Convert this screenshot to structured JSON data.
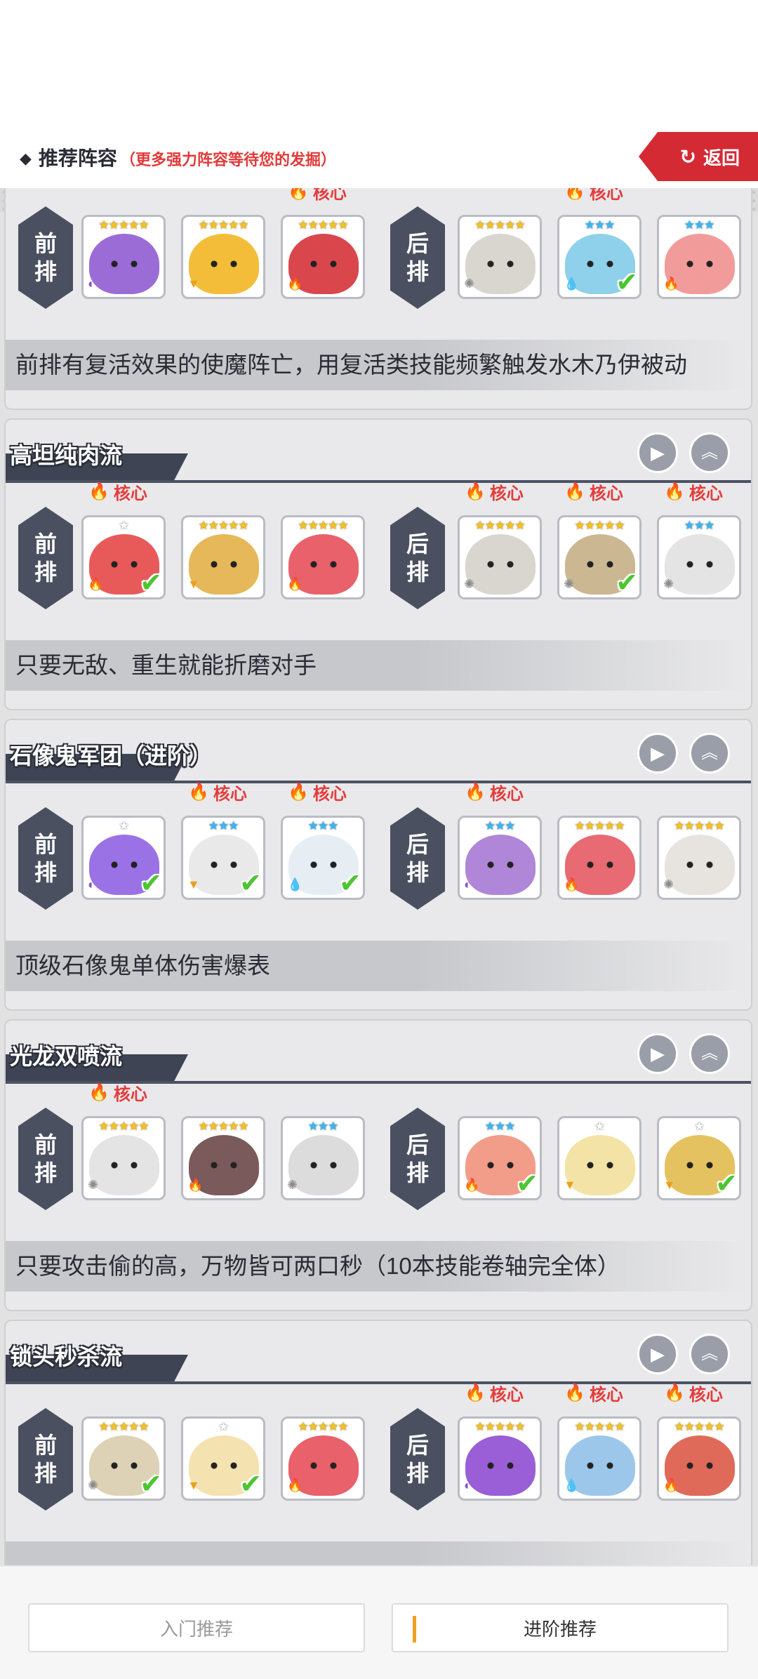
{
  "header": {
    "title": "推荐阵容",
    "subtitle": "（更多强力阵容等待您的发掘）",
    "back_label": "返回"
  },
  "labels": {
    "front": [
      "前",
      "排"
    ],
    "back": [
      "后",
      "排"
    ],
    "core": "核心"
  },
  "teams": [
    {
      "title": "",
      "description": "前排有复活效果的使魔阵亡，用复活类技能频繁触发水木乃伊被动",
      "heroes": [
        {
          "stars": "★★★★★",
          "star_color": "gold",
          "color": "#9b6cd6",
          "element": "dark",
          "core": false,
          "owned": false
        },
        {
          "stars": "★★★★★",
          "star_color": "gold",
          "color": "#f3bd3a",
          "element": "earth",
          "core": false,
          "owned": false
        },
        {
          "stars": "★★★★★",
          "star_color": "gold",
          "color": "#d9474d",
          "element": "fire",
          "core": true,
          "owned": false
        },
        {
          "stars": "★★★★★",
          "star_color": "gold",
          "color": "#d9d6d0",
          "element": "light",
          "core": false,
          "owned": false
        },
        {
          "stars": "★★★",
          "star_color": "blue",
          "color": "#8fd0ea",
          "element": "water",
          "core": true,
          "owned": true
        },
        {
          "stars": "★★★",
          "star_color": "blue",
          "color": "#f29b9b",
          "element": "fire",
          "core": false,
          "owned": false
        }
      ]
    },
    {
      "title": "高坦纯肉流",
      "description": "只要无敌、重生就能折磨对手",
      "heroes": [
        {
          "stars": "★",
          "star_color": "white",
          "color": "#e85a5a",
          "element": "fire",
          "core": true,
          "owned": true
        },
        {
          "stars": "★★★★★",
          "star_color": "gold",
          "color": "#e6b85a",
          "element": "earth",
          "core": false,
          "owned": false
        },
        {
          "stars": "★★★★★",
          "star_color": "gold",
          "color": "#e8616b",
          "element": "fire",
          "core": false,
          "owned": false
        },
        {
          "stars": "★★★★★",
          "star_color": "gold",
          "color": "#d9d6d0",
          "element": "light",
          "core": true,
          "owned": false
        },
        {
          "stars": "★★★★★",
          "star_color": "gold",
          "color": "#cbb892",
          "element": "light",
          "core": true,
          "owned": true
        },
        {
          "stars": "★★★",
          "star_color": "blue",
          "color": "#e4e4e4",
          "element": "light",
          "core": true,
          "owned": false
        }
      ]
    },
    {
      "title": "石像鬼军团（进阶）",
      "description": "顶级石像鬼单体伤害爆表",
      "heroes": [
        {
          "stars": "★",
          "star_color": "white",
          "color": "#9b72e6",
          "element": "dark",
          "core": false,
          "owned": true
        },
        {
          "stars": "★★★",
          "star_color": "blue",
          "color": "#e9e9e9",
          "element": "earth",
          "core": true,
          "owned": true
        },
        {
          "stars": "★★★",
          "star_color": "blue",
          "color": "#e6eef4",
          "element": "water",
          "core": true,
          "owned": true
        },
        {
          "stars": "★★★",
          "star_color": "blue",
          "color": "#b086d8",
          "element": "dark",
          "core": true,
          "owned": false
        },
        {
          "stars": "★★★★★",
          "star_color": "gold",
          "color": "#e86a72",
          "element": "fire",
          "core": false,
          "owned": false
        },
        {
          "stars": "★★★★★",
          "star_color": "gold",
          "color": "#e7e4e0",
          "element": "light",
          "core": false,
          "owned": false
        }
      ]
    },
    {
      "title": "光龙双喷流",
      "description": "只要攻击偷的高，万物皆可两口秒（10本技能卷轴完全体）",
      "heroes": [
        {
          "stars": "★★★★★",
          "star_color": "gold",
          "color": "#e4e4e4",
          "element": "light",
          "core": true,
          "owned": false
        },
        {
          "stars": "★★★★★",
          "star_color": "gold",
          "color": "#7a5a5a",
          "element": "fire",
          "core": false,
          "owned": false
        },
        {
          "stars": "★★★",
          "star_color": "blue",
          "color": "#dcdcdc",
          "element": "light",
          "core": false,
          "owned": false
        },
        {
          "stars": "★★★",
          "star_color": "blue",
          "color": "#f29c8a",
          "element": "fire",
          "core": false,
          "owned": true
        },
        {
          "stars": "★",
          "star_color": "white",
          "color": "#f3e3a6",
          "element": "earth",
          "core": false,
          "owned": false
        },
        {
          "stars": "★",
          "star_color": "white",
          "color": "#e4c260",
          "element": "earth",
          "core": false,
          "owned": true
        }
      ]
    },
    {
      "title": "锁头秒杀流",
      "description": "",
      "heroes": [
        {
          "stars": "★★★★★",
          "star_color": "gold",
          "color": "#ddd2b6",
          "element": "light",
          "core": false,
          "owned": true
        },
        {
          "stars": "★",
          "star_color": "white",
          "color": "#f4e2b0",
          "element": "earth",
          "core": false,
          "owned": true
        },
        {
          "stars": "★★★★★",
          "star_color": "gold",
          "color": "#e8616b",
          "element": "fire",
          "core": false,
          "owned": false
        },
        {
          "stars": "★★★★★",
          "star_color": "gold",
          "color": "#9a5fd6",
          "element": "dark",
          "core": true,
          "owned": false
        },
        {
          "stars": "★★★★★",
          "star_color": "gold",
          "color": "#9cc7ea",
          "element": "water",
          "core": true,
          "owned": false
        },
        {
          "stars": "★★★★★",
          "star_color": "gold",
          "color": "#e06a5a",
          "element": "fire",
          "core": true,
          "owned": false
        }
      ]
    }
  ],
  "footer": {
    "basic_label": "入门推荐",
    "advanced_label": "进阶推荐"
  }
}
